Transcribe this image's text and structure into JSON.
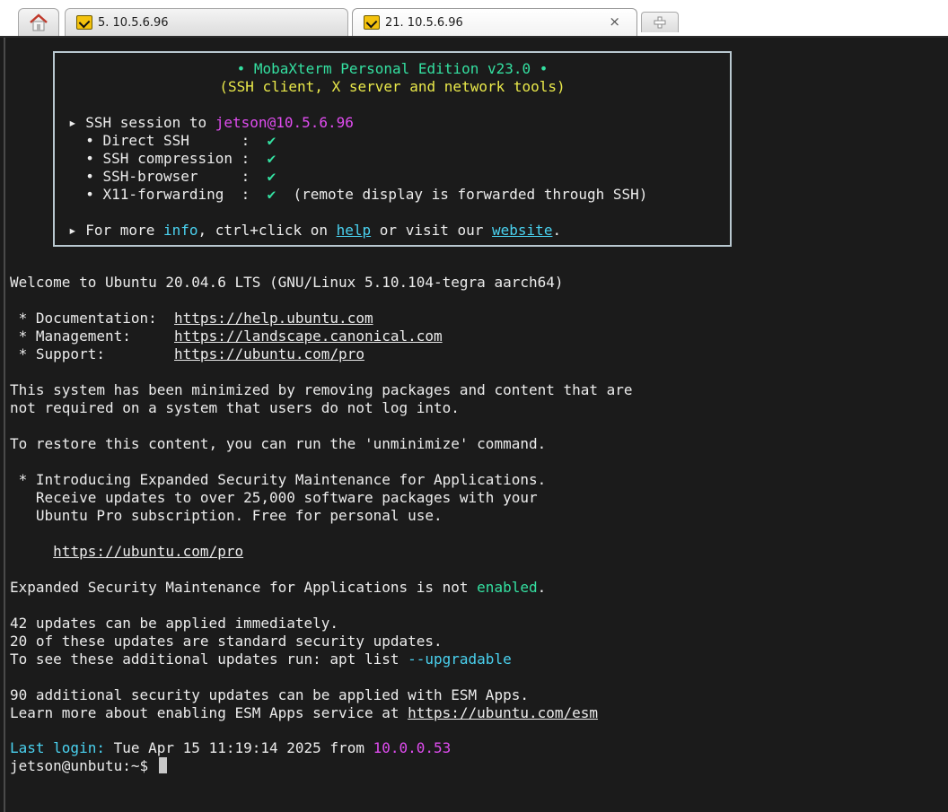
{
  "tabs": [
    {
      "label": "5. 10.5.6.96"
    },
    {
      "label": "21. 10.5.6.96",
      "close": "×"
    }
  ],
  "banner": {
    "title": "• MobaXterm Personal Edition v23.0 •",
    "subtitle": "(SSH client, X server and network tools)",
    "session_prefix": "▸ SSH session to ",
    "session_target": "jetson@10.5.6.96",
    "features": [
      {
        "label": "  • Direct SSH      :  ",
        "mark": "✔",
        "note": ""
      },
      {
        "label": "  • SSH compression :  ",
        "mark": "✔",
        "note": ""
      },
      {
        "label": "  • SSH-browser     :  ",
        "mark": "✔",
        "note": ""
      },
      {
        "label": "  • X11-forwarding  :  ",
        "mark": "✔",
        "note": "  (remote display is forwarded through SSH)"
      }
    ],
    "more_prefix": "▸ For more ",
    "more_info": "info",
    "more_mid": ", ctrl+click on ",
    "more_help": "help",
    "more_mid2": " or visit our ",
    "more_website": "website",
    "more_end": "."
  },
  "motd": {
    "welcome": "Welcome to Ubuntu 20.04.6 LTS (GNU/Linux 5.10.104-tegra aarch64)",
    "doc_label": " * Documentation:  ",
    "doc_url": "https://help.ubuntu.com",
    "mgmt_label": " * Management:     ",
    "mgmt_url": "https://landscape.canonical.com",
    "support_label": " * Support:        ",
    "support_url": "https://ubuntu.com/pro",
    "minimized_1": "This system has been minimized by removing packages and content that are",
    "minimized_2": "not required on a system that users do not log into.",
    "restore": "To restore this content, you can run the 'unminimize' command.",
    "esm_1": " * Introducing Expanded Security Maintenance for Applications.",
    "esm_2": "   Receive updates to over 25,000 software packages with your",
    "esm_3": "   Ubuntu Pro subscription. Free for personal use.",
    "pro_indent": "     ",
    "pro_url": "https://ubuntu.com/pro",
    "esm_status_prefix": "Expanded Security Maintenance for Applications is not ",
    "esm_status_word": "enabled",
    "esm_status_end": ".",
    "upd_1": "42 updates can be applied immediately.",
    "upd_2": "20 of these updates are standard security updates.",
    "upd_3_prefix": "To see these additional updates run: apt list ",
    "upd_3_opt": "--upgradable",
    "sec_1": "90 additional security updates can be applied with ESM Apps.",
    "sec_2_prefix": "Learn more about enabling ESM Apps service at ",
    "sec_2_url": "https://ubuntu.com/esm",
    "last_login_label": "Last login:",
    "last_login_mid": " Tue Apr 15 11:19:14 2025 from ",
    "last_login_ip": "10.0.0.53",
    "prompt": "jetson@unbutu:~$ "
  },
  "colors": {
    "background": "#1b1b1b",
    "text": "#ececec",
    "green": "#34e0a1",
    "yellow": "#e9e84a",
    "magenta": "#e04cf0",
    "cyan": "#4ad2f0"
  }
}
